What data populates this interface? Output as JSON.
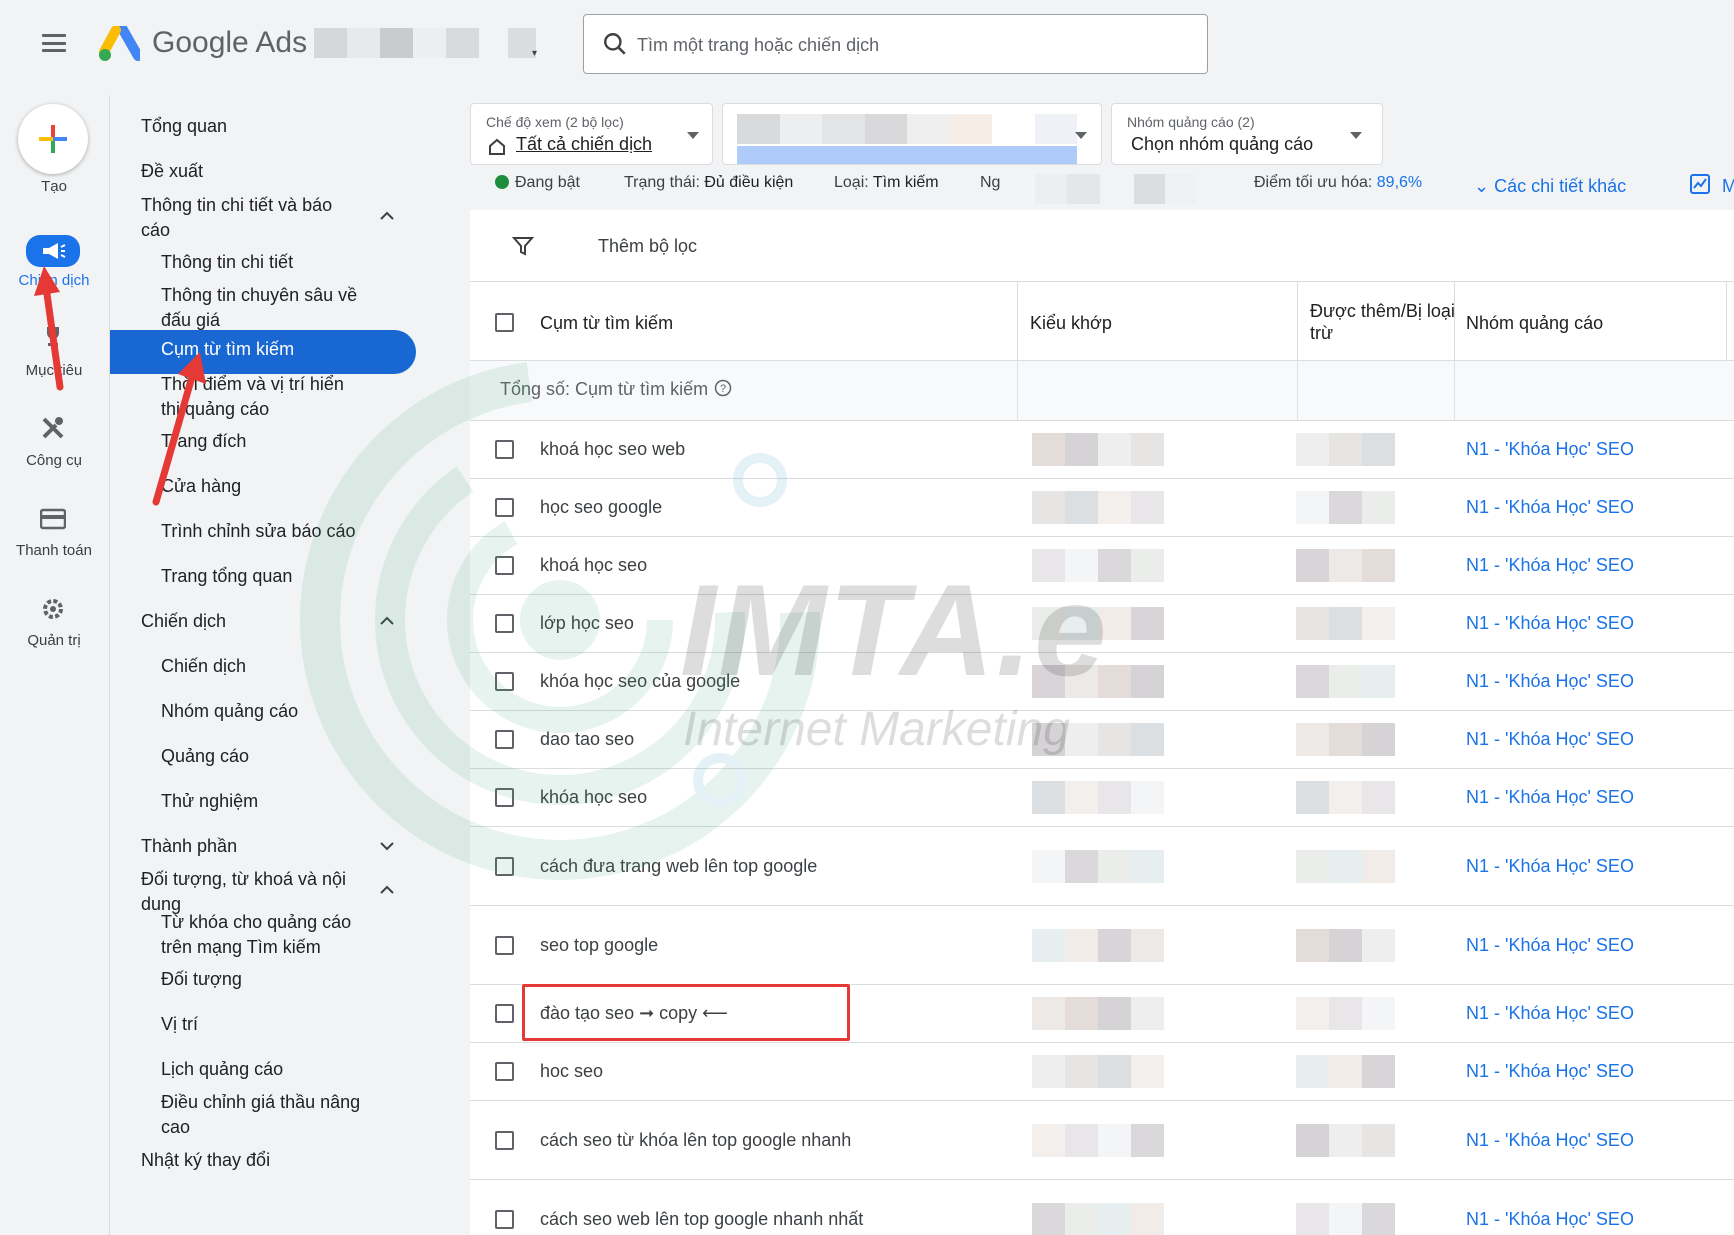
{
  "header": {
    "brand": "Google Ads",
    "search_placeholder": "Tìm một trang hoặc chiến dịch"
  },
  "rail": {
    "create": "Tạo",
    "items": [
      {
        "label": "Chiến dịch",
        "icon": "megaphone-icon"
      },
      {
        "label": "Mục tiêu",
        "icon": "trophy-icon"
      },
      {
        "label": "Công cụ",
        "icon": "tools-icon"
      },
      {
        "label": "Thanh toán",
        "icon": "credit-card-icon"
      },
      {
        "label": "Quản trị",
        "icon": "gear-icon"
      }
    ]
  },
  "nav": {
    "items": [
      "Tổng quan",
      "Đề xuất",
      "Thông tin chi tiết và báo cáo",
      "Thông tin chi tiết",
      "Thông tin chuyên sâu về đấu giá",
      "Cụm từ tìm kiếm",
      "Thời điểm và vị trí hiển thị quảng cáo",
      "Trang đích",
      "Cửa hàng",
      "Trình chỉnh sửa báo cáo",
      "Trang tổng quan",
      "Chiến dịch",
      "Chiến dịch",
      "Nhóm quảng cáo",
      "Quảng cáo",
      "Thử nghiệm",
      "Thành phần",
      "Đối tượng, từ khoá và nội dung",
      "Từ khóa cho quảng cáo trên mạng Tìm kiếm",
      "Đối tượng",
      "Vị trí",
      "Lịch quảng cáo",
      "Điều chỉnh giá thầu nâng cao",
      "Nhật ký thay đổi"
    ]
  },
  "filters": {
    "view_label": "Chế độ xem (2 bộ lọc)",
    "view_value": "Tất cả chiến dịch",
    "adgroup_label": "Nhóm quảng cáo (2)",
    "adgroup_value": "Chọn nhóm quảng cáo"
  },
  "status": {
    "enabled": "Đang bật",
    "state_label": "Trạng thái:",
    "state_value": "Đủ điều kiện",
    "type_label": "Loại:",
    "type_value": "Tìm kiếm",
    "budget_label": "Ng",
    "opt_label": "Điểm tối ưu hóa:",
    "opt_value": "89,6%",
    "more": "Các chi tiết khác",
    "extra": "M"
  },
  "table": {
    "add_filter": "Thêm bộ lọc",
    "columns": [
      "Cụm từ tìm kiếm",
      "Kiểu khớp",
      "Được thêm/Bị loại trừ",
      "Nhóm quảng cáo"
    ],
    "total": "Tổng số: Cụm từ tìm kiếm",
    "rows": [
      {
        "term": "khoá học seo web",
        "adgroup": "N1 - 'Khóa Học' SEO"
      },
      {
        "term": "học seo google",
        "adgroup": "N1 - 'Khóa Học' SEO"
      },
      {
        "term": "khoá học seo",
        "adgroup": "N1 - 'Khóa Học' SEO"
      },
      {
        "term": "lớp học seo",
        "adgroup": "N1 - 'Khóa Học' SEO"
      },
      {
        "term": "khóa học seo của google",
        "adgroup": "N1 - 'Khóa Học' SEO"
      },
      {
        "term": "dao tao seo",
        "adgroup": "N1 - 'Khóa Học' SEO"
      },
      {
        "term": "khóa học seo",
        "adgroup": "N1 - 'Khóa Học' SEO"
      },
      {
        "term": "cách đưa trang web lên top google",
        "adgroup": "N1 - 'Khóa Học' SEO"
      },
      {
        "term": "seo top google",
        "adgroup": "N1 - 'Khóa Học' SEO"
      },
      {
        "term": "đào tạo seo ➞ copy ⟵",
        "adgroup": "N1 - 'Khóa Học' SEO"
      },
      {
        "term": "hoc seo",
        "adgroup": "N1 - 'Khóa Học' SEO"
      },
      {
        "term": "cách seo từ khóa lên top google nhanh",
        "adgroup": "N1 - 'Khóa Học' SEO"
      },
      {
        "term": "cách seo web lên top google nhanh nhất",
        "adgroup": "N1 - 'Khóa Học' SEO"
      }
    ]
  },
  "watermark": {
    "title": "IMTA.e",
    "subtitle": "Internet Marketing"
  },
  "colors": {
    "accent": "#1a73e8",
    "nav_active": "#1967d2",
    "highlight": "#e53935"
  }
}
